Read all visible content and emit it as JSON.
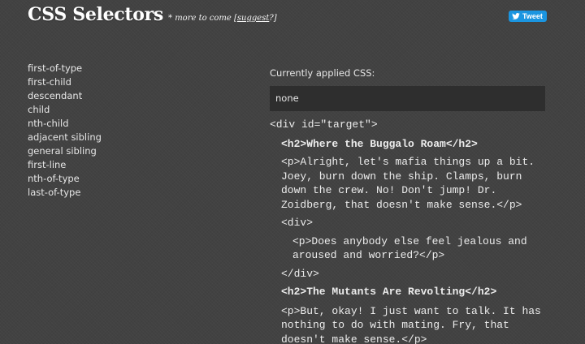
{
  "header": {
    "title": "CSS Selectors",
    "tagline_prefix": "* more to come [",
    "tagline_link": "suggest",
    "tagline_suffix": "?]",
    "tweet_label": "Tweet"
  },
  "selectors": [
    "first-of-type",
    "first-child",
    "descendant",
    "child",
    "nth-child",
    "adjacent sibling",
    "general sibling",
    "first-line",
    "nth-of-type",
    "last-of-type"
  ],
  "applied": {
    "label": "Currently applied CSS:",
    "value": "none"
  },
  "code": {
    "div_open": "<div id=\"target\">",
    "h2_1": "<h2>Where the Buggalo Roam</h2>",
    "p_1": "<p>Alright, let's mafia things up a bit. Joey, burn down the ship. Clamps, burn down the crew. No! Don't jump! Dr. Zoidberg, that doesn't make sense.</p>",
    "inner_div_open": "<div>",
    "p_inner": "<p>Does anybody else feel jealous and aroused and worried?</p>",
    "inner_div_close": "</div>",
    "h2_2": "<h2>The Mutants Are Revolting</h2>",
    "p_2": "<p>But, okay! I just want to talk. It has nothing to do with mating. Fry, that doesn't make sense.</p>"
  },
  "colors": {
    "background": "#424242",
    "applied_box": "#2e2e2e",
    "tweet_button": "#1b95e0"
  },
  "icons": {
    "tweet": "twitter-bird-icon"
  }
}
